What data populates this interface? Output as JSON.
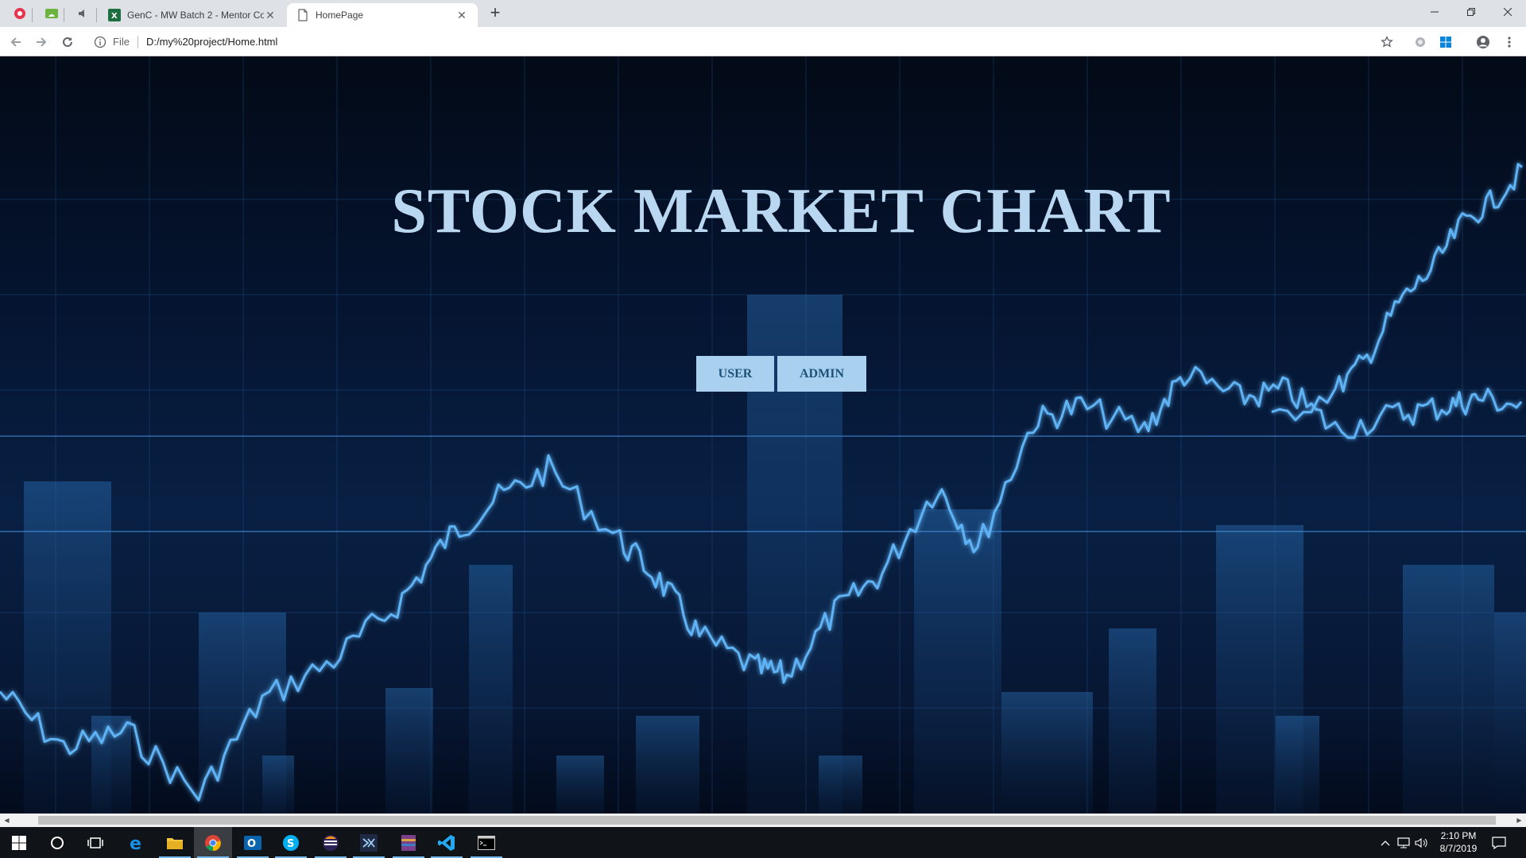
{
  "browser": {
    "tabs": [
      {
        "title": "GenC - MW Batch 2 - Mentor Co",
        "active": false
      },
      {
        "title": "HomePage",
        "active": true
      }
    ],
    "address": {
      "scheme_label": "File",
      "url": "D:/my%20project/Home.html"
    }
  },
  "page": {
    "title": "STOCK MARKET CHART",
    "buttons": {
      "user": "USER",
      "admin": "ADMIN"
    },
    "colors": {
      "title": "#b9d7f0",
      "button_bg": "#a9d0ef",
      "button_text": "#1f5279"
    }
  },
  "taskbar": {
    "apps": [
      "start",
      "cortana-search",
      "task-view",
      "edge",
      "file-explorer",
      "chrome",
      "outlook",
      "skype",
      "eclipse",
      "visual-studio",
      "winrar",
      "vscode",
      "cmd"
    ],
    "clock": {
      "time": "2:10 PM",
      "date": "8/7/2019"
    }
  }
}
